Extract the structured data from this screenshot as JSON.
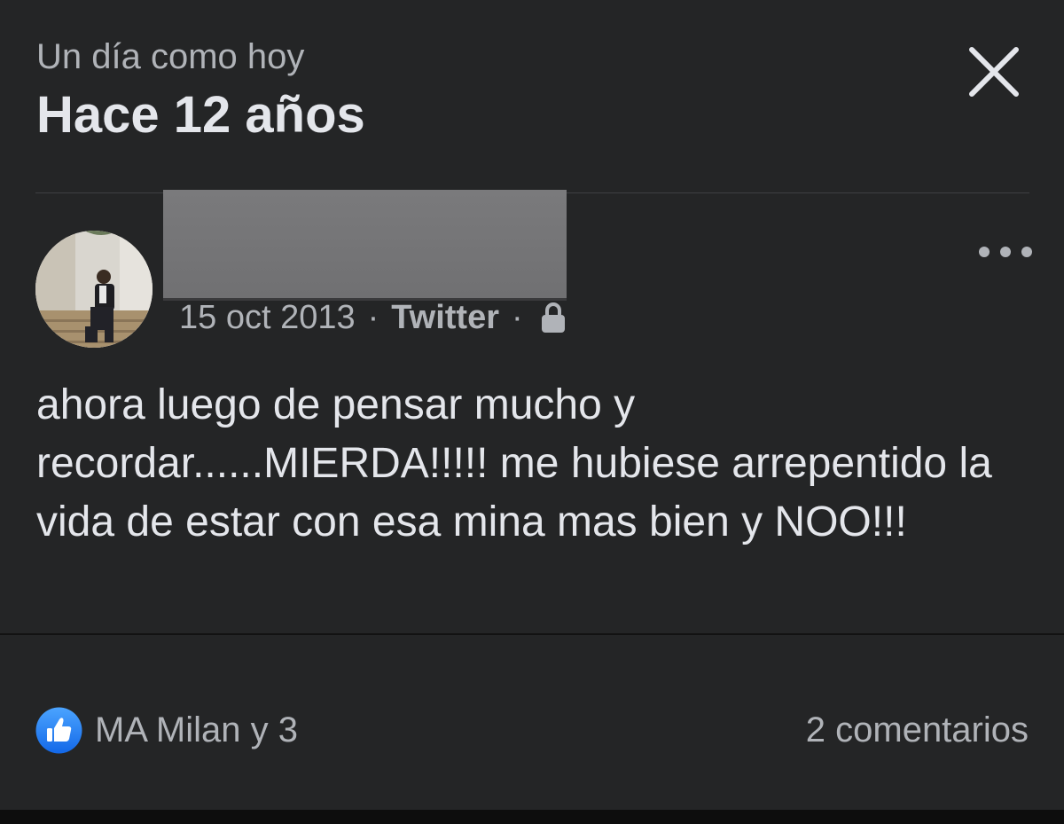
{
  "header": {
    "subtitle": "Un día como hoy",
    "title": "Hace 12 años",
    "close_icon": "close-icon"
  },
  "post": {
    "date": "15 oct 2013",
    "separator": "·",
    "source": "Twitter",
    "privacy_icon": "lock-icon",
    "more_icon": "more-options-icon",
    "text": "ahora luego de pensar mucho y recordar......MIERDA!!!!! me hubiese arrepentido la vida de estar con esa mina mas bien y NOO!!!"
  },
  "footer": {
    "reaction_icon": "like-icon",
    "reactions_label": "MA Milan y 3",
    "comments_label": "2 comentarios"
  },
  "colors": {
    "background": "#242526",
    "primary_text": "#e4e6eb",
    "secondary_text": "#b0b3b8",
    "like_blue": "#1877f2"
  }
}
